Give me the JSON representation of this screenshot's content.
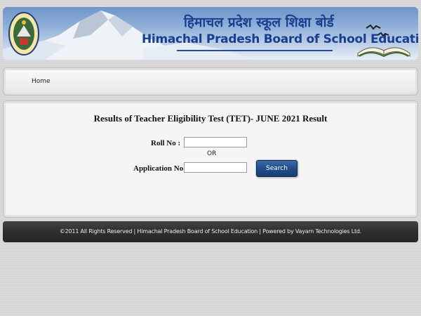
{
  "header": {
    "title_hindi": "हिमाचल प्रदेश स्कूल शिक्षा बोर्ड",
    "title_english": "Himachal Pradesh Board of School Education"
  },
  "nav": {
    "home_label": "Home"
  },
  "form": {
    "title": "Results of Teacher Eligibility Test (TET)- JUNE 2021 Result",
    "roll_label": "Roll No :",
    "roll_value": "",
    "or_label": "OR",
    "application_label": "Application No :",
    "application_value": "",
    "search_label": "Search"
  },
  "footer": {
    "text": "©2011 All Rights Reserved | Himachal Pradesh Board of School Education | Powered by Vayam Technologies Ltd."
  },
  "colors": {
    "header_title": "#1a3d8f",
    "search_button": "#1f4d8a",
    "footer_bg": "#2e2e2e"
  }
}
